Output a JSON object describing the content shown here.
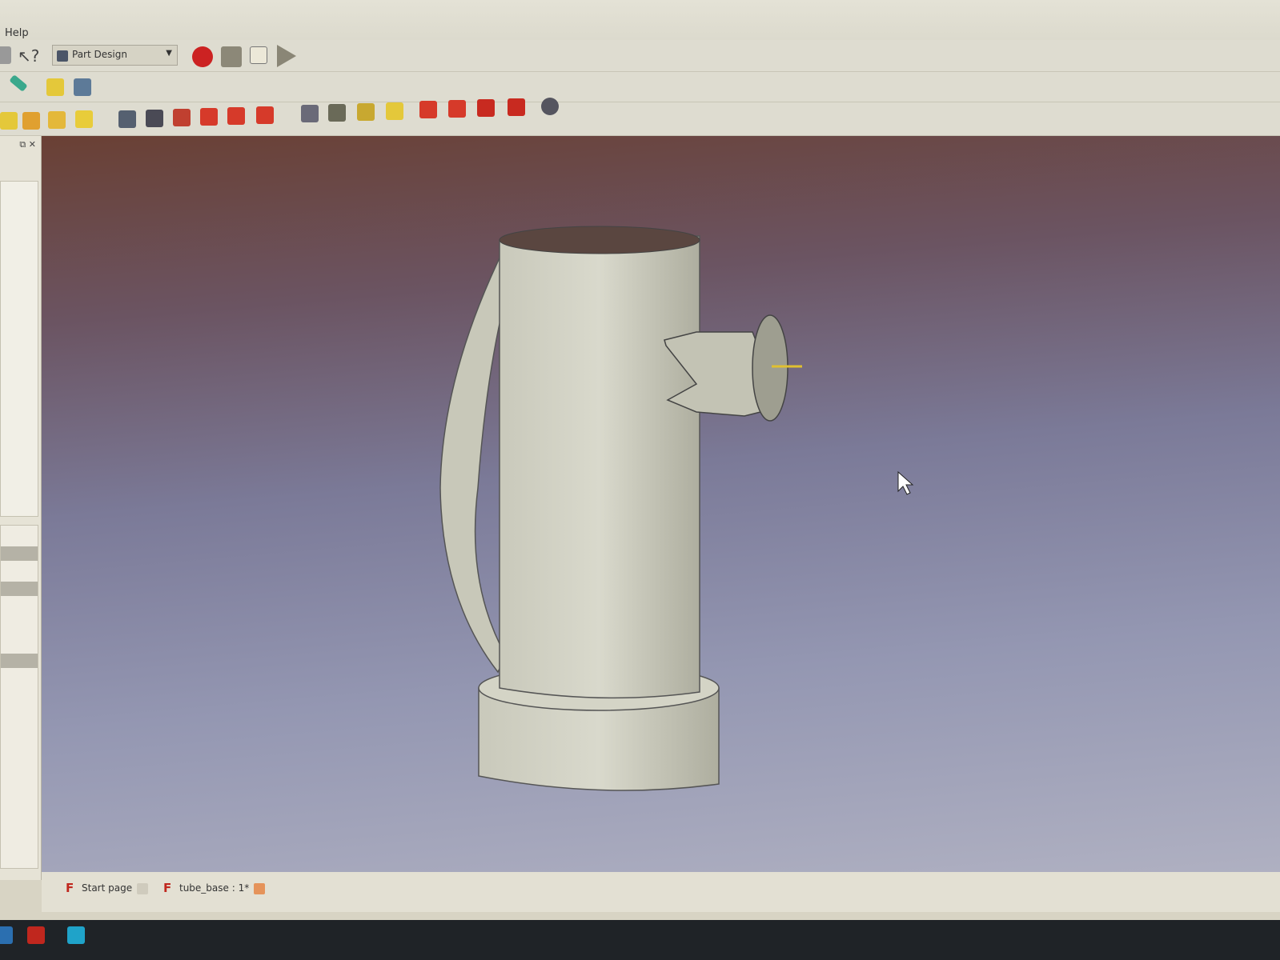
{
  "menu": {
    "help": "Help"
  },
  "toolbar": {
    "workbench": "Part Design"
  },
  "panel": {
    "controls": "⧉ ✕"
  },
  "tabs": [
    {
      "label": "Start page"
    },
    {
      "label": "tube_base : 1*"
    }
  ],
  "colors": {
    "record": "#cc2222",
    "feature_red": "#d63a2a",
    "feature_yellow": "#e8cc3a"
  }
}
